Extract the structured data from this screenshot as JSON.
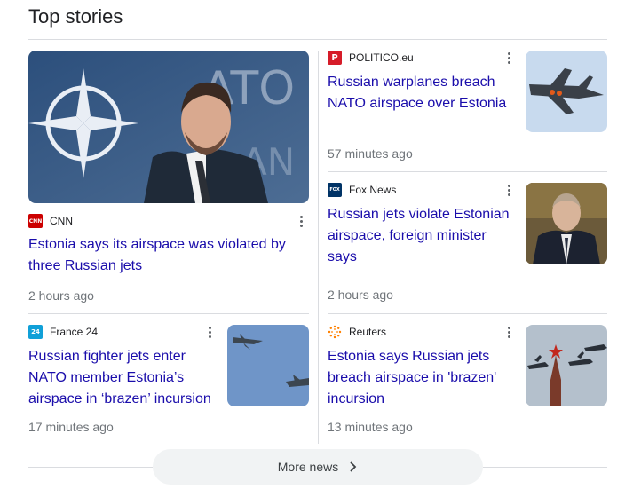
{
  "section": {
    "title": "Top stories"
  },
  "stories": [
    {
      "source": "CNN",
      "favicon_color": "#cc0000",
      "favicon_text": "CNN",
      "headline": "Estonia says its airspace was violated by three Russian jets",
      "age": "2 hours ago",
      "image": "man-speaking-nato-logo-backdrop"
    },
    {
      "source": "POLITICO.eu",
      "favicon_color": "#d61c29",
      "favicon_text": "P",
      "headline": "Russian warplanes breach NATO airspace over Estonia",
      "age": "57 minutes ago",
      "image": "fighter-jet-in-sky"
    },
    {
      "source": "Fox News",
      "favicon_color": "#003366",
      "favicon_text": "FOX",
      "headline": "Russian jets violate Estonian airspace, foreign minister says",
      "age": "2 hours ago",
      "image": "man-in-dark-suit-seated"
    },
    {
      "source": "France 24",
      "favicon_color": "#10a0d8",
      "favicon_text": "24",
      "headline": "Russian fighter jets enter NATO member Estonia’s airspace in ‘brazen’ incursion",
      "age": "17 minutes ago",
      "image": "two-jets-in-blue-sky"
    },
    {
      "source": "Reuters",
      "favicon_color": "#ff8000",
      "favicon_text": "",
      "headline": "Estonia says Russian jets breach airspace in 'brazen' incursion",
      "age": "13 minutes ago",
      "image": "jets-over-kremlin-tower"
    }
  ],
  "more": {
    "label": "More news"
  },
  "colors": {
    "link": "#1a0dab",
    "meta": "#70757a",
    "divider": "#dadce0"
  }
}
